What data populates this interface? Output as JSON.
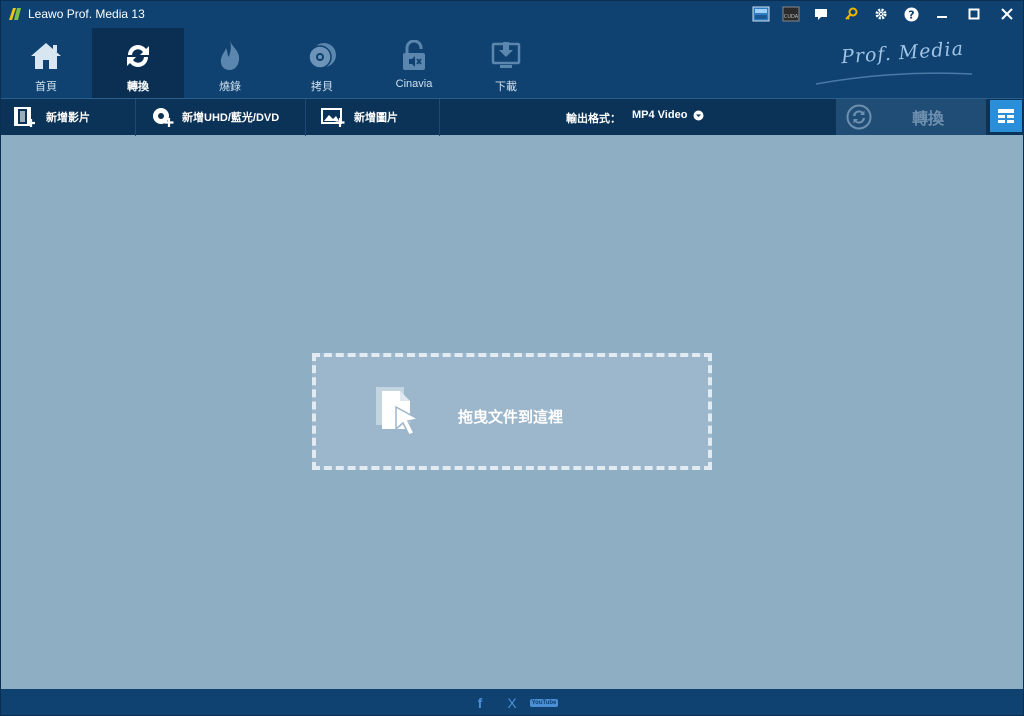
{
  "window": {
    "title": "Leawo Prof. Media 13"
  },
  "titlebar_icons": [
    "hardware-accel-icon",
    "cuda-icon",
    "chat-icon",
    "key-icon",
    "gear-icon",
    "help-icon",
    "minimize-icon",
    "maximize-icon",
    "close-icon"
  ],
  "titlebar_icon_text": {
    "cuda": "CUDA"
  },
  "modules": [
    {
      "label": "首頁",
      "icon": "home-icon"
    },
    {
      "label": "轉換",
      "icon": "convert-icon",
      "active": true
    },
    {
      "label": "燒錄",
      "icon": "burn-icon"
    },
    {
      "label": "拷貝",
      "icon": "copy-disc-icon"
    },
    {
      "label": "Cinavia",
      "icon": "cinavia-icon"
    },
    {
      "label": "下載",
      "icon": "download-icon"
    }
  ],
  "brand": {
    "logo_text": "Prof. Media"
  },
  "toolbar": {
    "add_video": "新增影片",
    "add_disc": "新增UHD/藍光/DVD",
    "add_photo": "新增圖片",
    "output_label": "輸出格式：",
    "output_format": "MP4 Video",
    "convert": "轉換"
  },
  "dropzone": {
    "text": "拖曳文件到這裡"
  },
  "footer": {
    "social": [
      {
        "name": "facebook-icon",
        "glyph": "f"
      },
      {
        "name": "x-icon",
        "glyph": "X"
      },
      {
        "name": "youtube-icon",
        "glyph": "YouTube"
      }
    ]
  },
  "colors": {
    "titlebar": "#0f4271",
    "toolbar": "#0b3358",
    "workspace": "#8eaec4",
    "accent": "#2a8fd8"
  }
}
